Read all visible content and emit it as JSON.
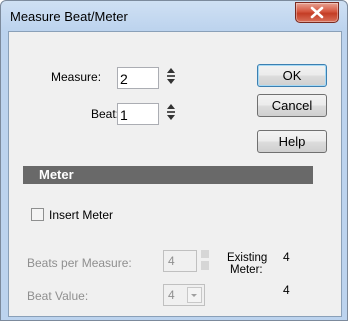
{
  "window": {
    "title": "Measure Beat/Meter"
  },
  "position": {
    "measure_label": "Measure:",
    "measure_value": "2",
    "beat_label": "Beat:",
    "beat_value": "1"
  },
  "buttons": {
    "ok": "OK",
    "cancel": "Cancel",
    "help": "Help"
  },
  "meter": {
    "section_title": "Meter",
    "insert_meter_label": "Insert Meter",
    "insert_meter_checked": false,
    "beats_per_measure_label": "Beats per Measure:",
    "beats_per_measure_value": "4",
    "beat_value_label": "Beat Value:",
    "beat_value_value": "4",
    "existing_meter_label_line1": "Existing",
    "existing_meter_label_line2": "Meter:",
    "existing_meter_top": "4",
    "existing_meter_bottom": "4"
  }
}
